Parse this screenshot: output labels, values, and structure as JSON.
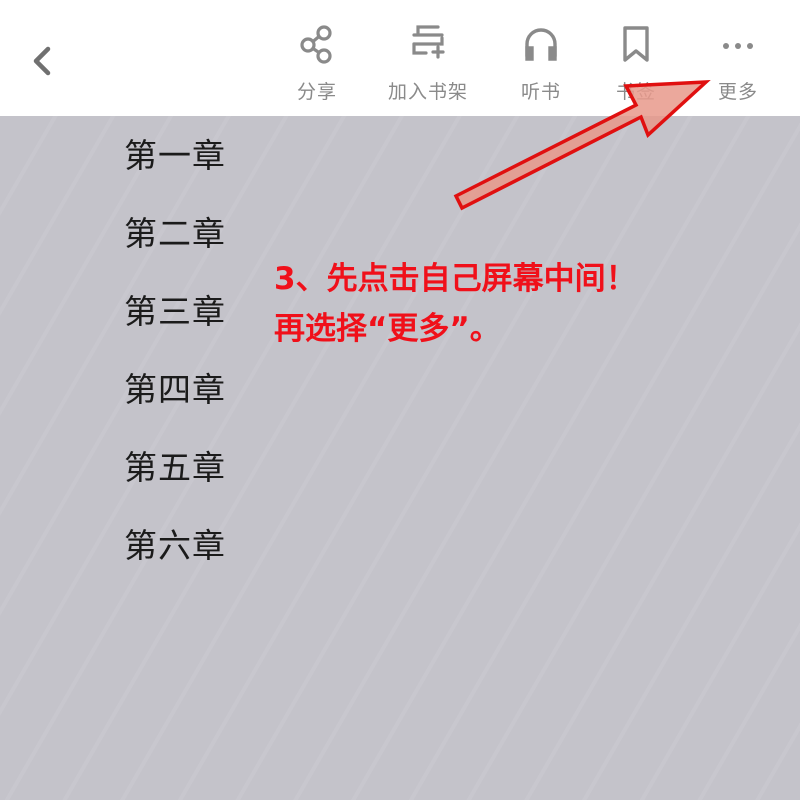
{
  "toolbar": {
    "share_label": "分享",
    "add_shelf_label": "加入书架",
    "listen_label": "听书",
    "bookmark_label": "书签",
    "more_label": "更多"
  },
  "chapters": [
    "第一章",
    "第二章",
    "第三章",
    "第四章",
    "第五章",
    "第六章"
  ],
  "annotation": {
    "line1": "3、先点击自己屏幕中间！",
    "line2": "再选择“更多”。"
  },
  "colors": {
    "content_background": "#c4c3ca",
    "toolbar_background": "#ffffff",
    "annotation_red": "#f0101a",
    "icon_gray": "#8a8a8a"
  },
  "icons": [
    "chevron-left-icon",
    "share-icon",
    "add-to-shelf-icon",
    "headphones-icon",
    "bookmark-icon",
    "more-dots-icon"
  ]
}
